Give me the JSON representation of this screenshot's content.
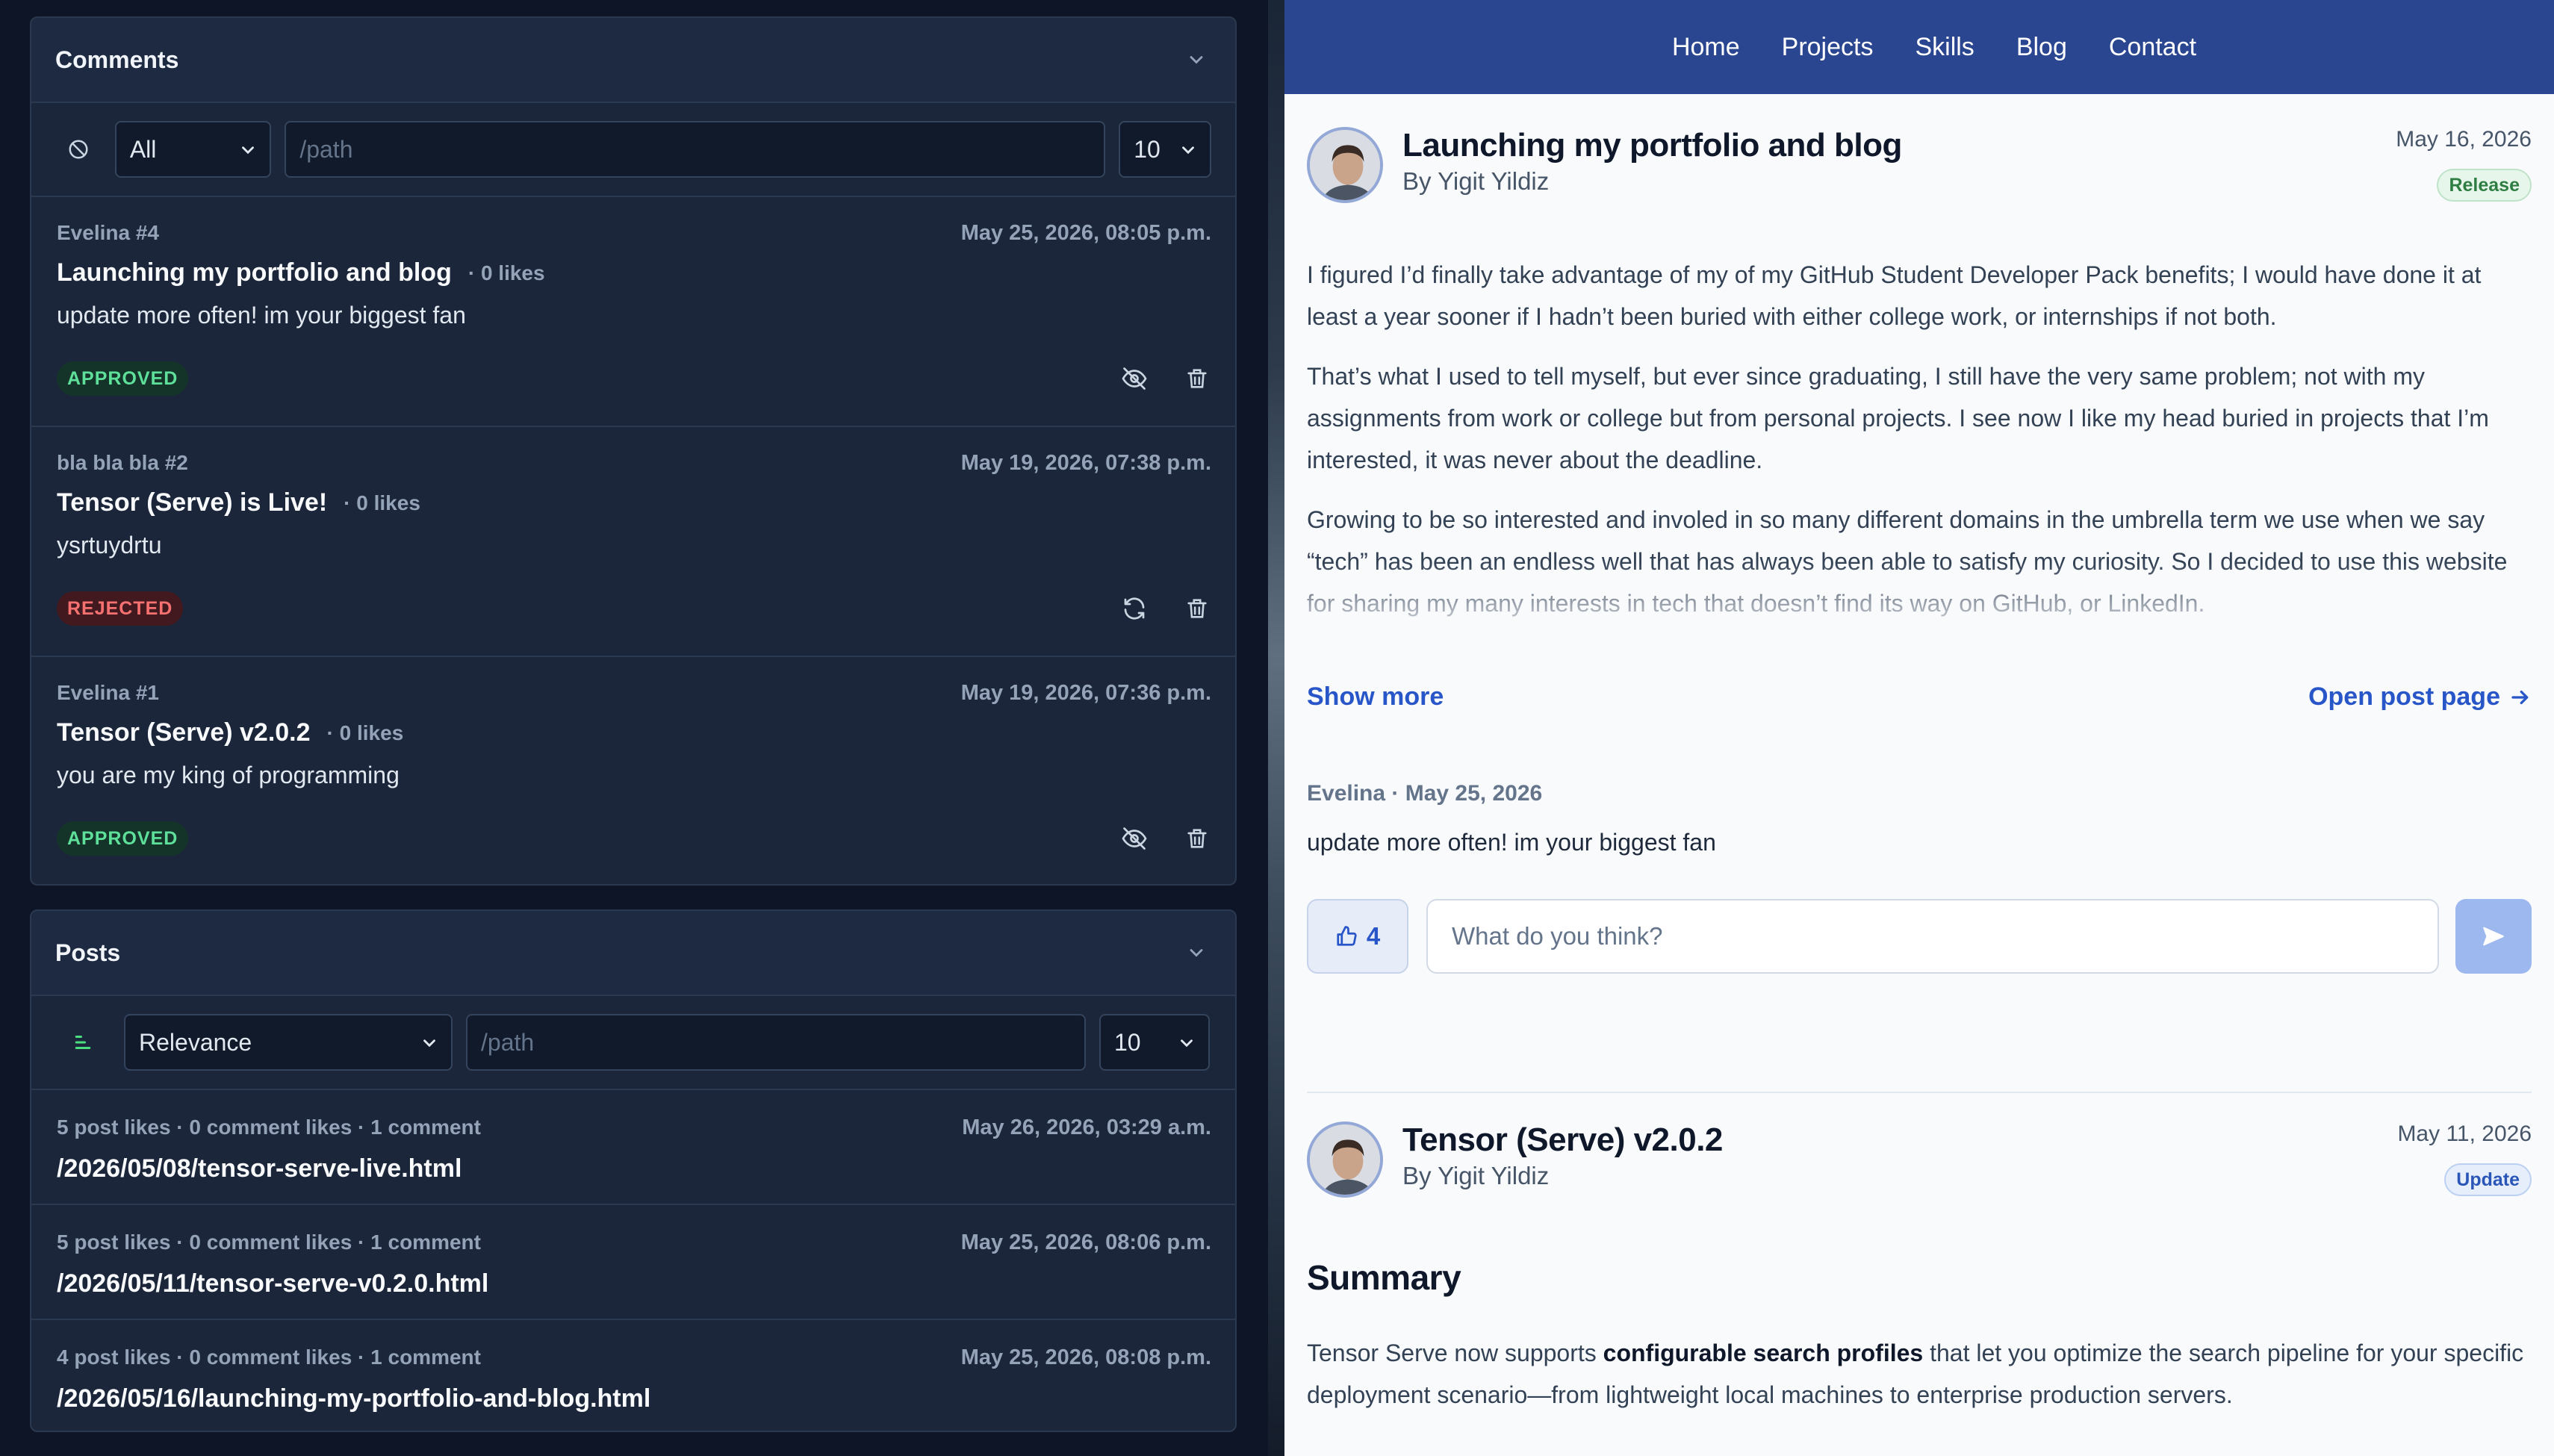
{
  "admin": {
    "comments": {
      "title": "Comments",
      "filter": {
        "status": "All",
        "path_placeholder": "/path",
        "limit": "10"
      },
      "items": [
        {
          "author": "Evelina #4",
          "date": "May 25, 2026, 08:05 p.m.",
          "post": "Launching my portfolio and blog",
          "likes": "· 0 likes",
          "body": "update more often! im your biggest fan",
          "status": "APPROVED"
        },
        {
          "author": "bla bla bla #2",
          "date": "May 19, 2026, 07:38 p.m.",
          "post": "Tensor (Serve) is Live!",
          "likes": "· 0 likes",
          "body": "ysrtuydrtu",
          "status": "REJECTED"
        },
        {
          "author": "Evelina #1",
          "date": "May 19, 2026, 07:36 p.m.",
          "post": "Tensor (Serve) v2.0.2",
          "likes": "· 0 likes",
          "body": "you are my king of programming",
          "status": "APPROVED"
        }
      ]
    },
    "posts": {
      "title": "Posts",
      "filter": {
        "sort": "Relevance",
        "path_placeholder": "/path",
        "limit": "10"
      },
      "items": [
        {
          "stats": "5 post likes · 0 comment likes · 1 comment",
          "date": "May 26, 2026, 03:29 a.m.",
          "path": "/2026/05/08/tensor-serve-live.html"
        },
        {
          "stats": "5 post likes · 0 comment likes · 1 comment",
          "date": "May 25, 2026, 08:06 p.m.",
          "path": "/2026/05/11/tensor-serve-v0.2.0.html"
        },
        {
          "stats": "4 post likes · 0 comment likes · 1 comment",
          "date": "May 25, 2026, 08:08 p.m.",
          "path": "/2026/05/16/launching-my-portfolio-and-blog.html"
        }
      ]
    }
  },
  "site": {
    "nav": [
      "Home",
      "Projects",
      "Skills",
      "Blog",
      "Contact"
    ],
    "post1": {
      "title": "Launching my portfolio and blog",
      "byline": "By Yigit Yildiz",
      "date": "May 16, 2026",
      "tag": "Release",
      "paragraphs": [
        "I figured I’d finally take advantage of my of my GitHub Student Developer Pack benefits; I would have done it at least a year sooner if I hadn’t been buried with either college work, or internships if not both.",
        "That’s what I used to tell myself, but ever since graduating, I still have the very same problem; not with my assignments from work or college but from personal projects. I see now I like my head buried in projects that I’m interested, it was never about the deadline.",
        "Growing to be so interested and involed in so many different domains in the umbrella term we use when we say “tech” has been an endless well that has always been able to satisfy my curiosity. So I decided to use this website for sharing my many interests in tech that doesn’t find its way on GitHub, or LinkedIn."
      ],
      "show_more": "Show more",
      "open_post": "Open post page",
      "comment_meta": "Evelina · May 25, 2026",
      "comment_body": "update more often! im your biggest fan",
      "likes": "4",
      "comment_placeholder": "What do you think?"
    },
    "post2": {
      "title": "Tensor (Serve) v2.0.2",
      "byline": "By Yigit Yildiz",
      "date": "May 11, 2026",
      "tag": "Update",
      "heading": "Summary",
      "text_before": "Tensor Serve now supports ",
      "text_bold": "configurable search profiles",
      "text_after": " that let you optimize the search pipeline for your specific deployment scenario—from lightweight local machines to enterprise production servers."
    }
  }
}
